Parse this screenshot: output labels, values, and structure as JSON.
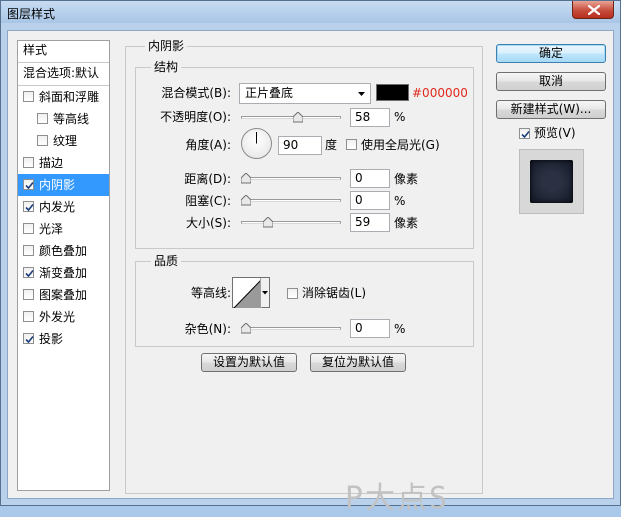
{
  "window": {
    "title": "图层样式"
  },
  "styles": {
    "header": "样式",
    "blend_default": "混合选项:默认",
    "items": [
      {
        "label": "斜面和浮雕",
        "checked": false,
        "indent": false,
        "selected": false
      },
      {
        "label": "等高线",
        "checked": false,
        "indent": true,
        "selected": false
      },
      {
        "label": "纹理",
        "checked": false,
        "indent": true,
        "selected": false
      },
      {
        "label": "描边",
        "checked": false,
        "indent": false,
        "selected": false
      },
      {
        "label": "内阴影",
        "checked": true,
        "indent": false,
        "selected": true
      },
      {
        "label": "内发光",
        "checked": true,
        "indent": false,
        "selected": false
      },
      {
        "label": "光泽",
        "checked": false,
        "indent": false,
        "selected": false
      },
      {
        "label": "颜色叠加",
        "checked": false,
        "indent": false,
        "selected": false
      },
      {
        "label": "渐变叠加",
        "checked": true,
        "indent": false,
        "selected": false
      },
      {
        "label": "图案叠加",
        "checked": false,
        "indent": false,
        "selected": false
      },
      {
        "label": "外发光",
        "checked": false,
        "indent": false,
        "selected": false
      },
      {
        "label": "投影",
        "checked": true,
        "indent": false,
        "selected": false
      }
    ]
  },
  "inner_shadow": {
    "title": "内阴影",
    "structure": {
      "title": "结构",
      "blend_mode_label": "混合模式(B):",
      "blend_mode_value": "正片叠底",
      "color_hex": "#000000",
      "opacity_label": "不透明度(O):",
      "opacity_value": "58",
      "opacity_fraction": 0.58,
      "percent": "%",
      "angle_label": "角度(A):",
      "angle_value": "90",
      "angle_unit": "度",
      "global_light_label": "使用全局光(G)",
      "global_light_checked": false,
      "distance_label": "距离(D):",
      "distance_value": "0",
      "distance_fraction": 0,
      "pixels": "像素",
      "choke_label": "阻塞(C):",
      "choke_value": "0",
      "choke_fraction": 0,
      "size_label": "大小(S):",
      "size_value": "59",
      "size_fraction": 0.24
    },
    "quality": {
      "title": "品质",
      "contour_label": "等高线:",
      "anti_alias_label": "消除锯齿(L)",
      "anti_alias_checked": false,
      "noise_label": "杂色(N):",
      "noise_value": "0",
      "noise_fraction": 0,
      "percent": "%"
    },
    "set_default": "设置为默认值",
    "reset_default": "复位为默认值"
  },
  "buttons": {
    "ok": "确定",
    "cancel": "取消",
    "new_style": "新建样式(W)...",
    "preview_label": "预览(V)",
    "preview_checked": true
  },
  "watermark": "P大点S",
  "colors": {
    "selected_bg": "#3399ff",
    "hex_text": "#e0281c",
    "swatch": "#000000"
  }
}
